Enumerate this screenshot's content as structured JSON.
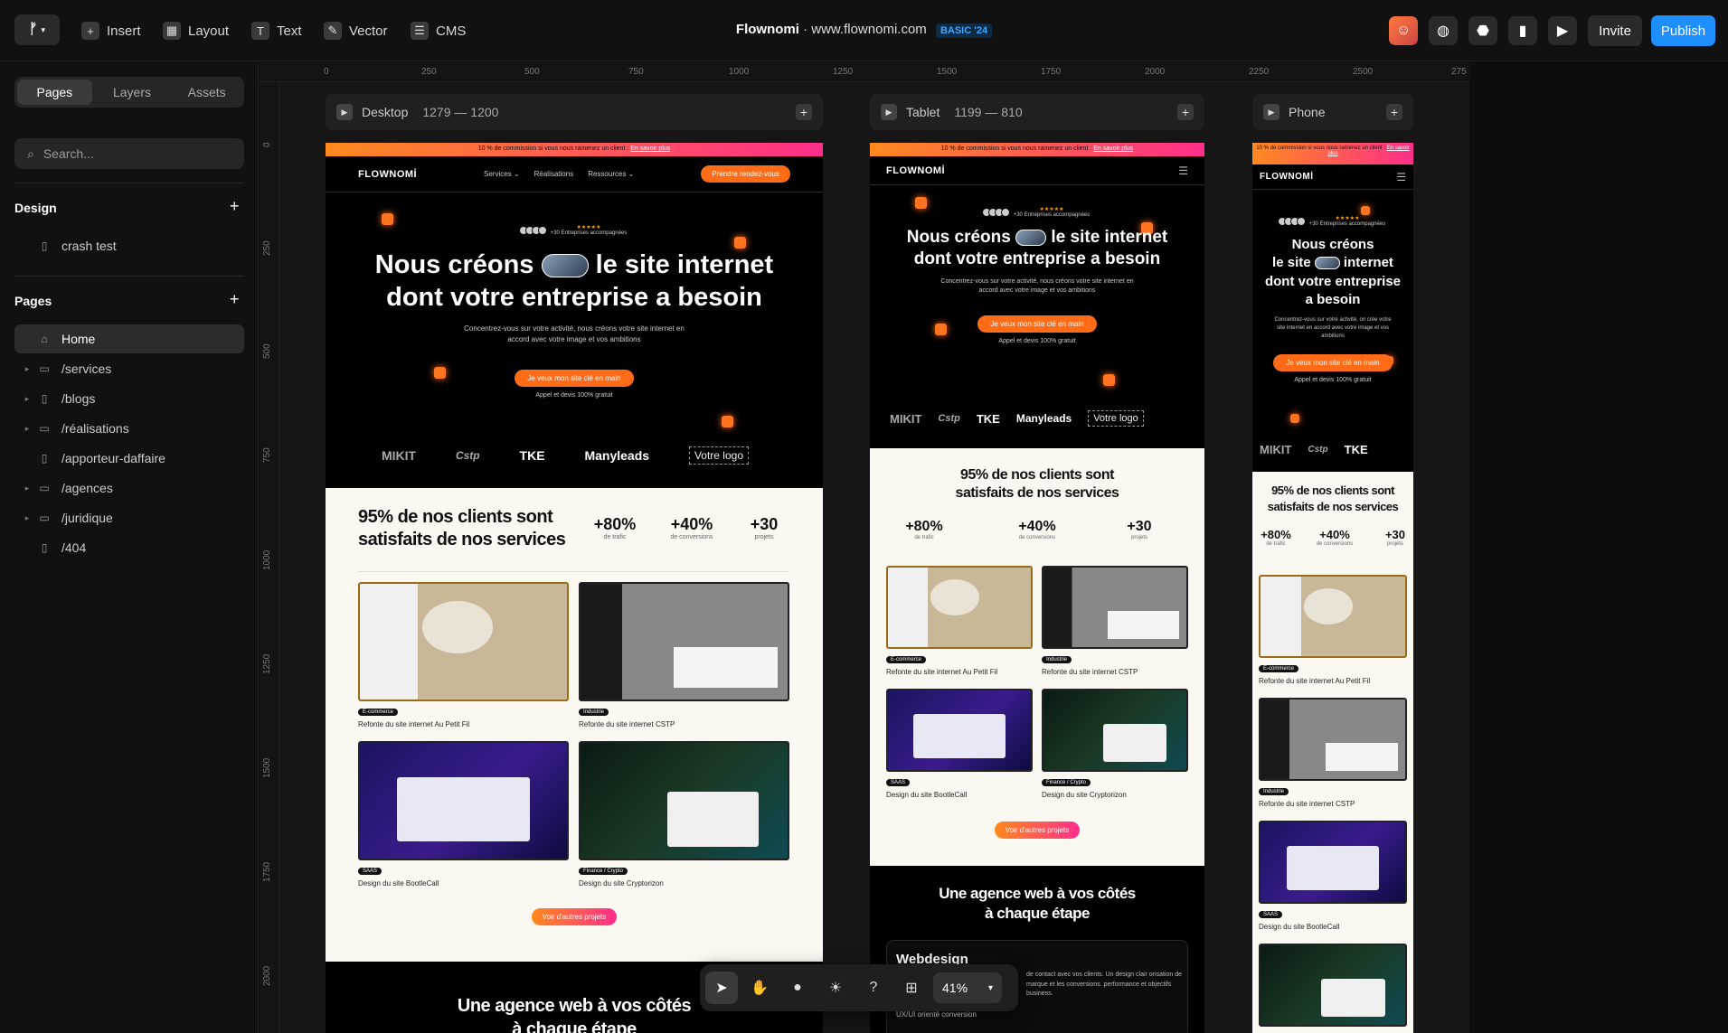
{
  "topbar": {
    "insert": "Insert",
    "layout": "Layout",
    "text": "Text",
    "vector": "Vector",
    "cms": "CMS",
    "project_name": "Flownomi",
    "separator": "·",
    "domain": "www.flownomi.com",
    "plan_badge": "BASIC '24",
    "invite": "Invite",
    "publish": "Publish"
  },
  "sidebar": {
    "tabs": [
      "Pages",
      "Layers",
      "Assets"
    ],
    "search_placeholder": "Search...",
    "design_title": "Design",
    "design_items": [
      "crash test"
    ],
    "pages_title": "Pages",
    "pages": [
      {
        "label": "Home",
        "icon": "home-icon",
        "active": true
      },
      {
        "label": "/services",
        "icon": "folder-icon"
      },
      {
        "label": "/blogs",
        "icon": "page-icon"
      },
      {
        "label": "/réalisations",
        "icon": "folder-icon"
      },
      {
        "label": "/apporteur-daffaire",
        "icon": "page-icon"
      },
      {
        "label": "/agences",
        "icon": "folder-icon"
      },
      {
        "label": "/juridique",
        "icon": "folder-icon"
      },
      {
        "label": "/404",
        "icon": "page-icon"
      }
    ]
  },
  "rulers": {
    "h": [
      "0",
      "250",
      "500",
      "750",
      "1000",
      "1250",
      "1500",
      "1750",
      "2000",
      "2250",
      "2500",
      "275"
    ],
    "v": [
      "0",
      "250",
      "500",
      "750",
      "1000",
      "1250",
      "1500",
      "1750",
      "2000"
    ]
  },
  "breakpoints": {
    "desktop": {
      "name": "Desktop",
      "size": "1279 — 1200"
    },
    "tablet": {
      "name": "Tablet",
      "size": "1199 — 810"
    },
    "phone": {
      "name": "Phone",
      "size": ""
    }
  },
  "site": {
    "promo": "10 % de commission si vous nous ramenez un client :",
    "promo_link": "En savoir plus",
    "brand": "FLOWNOMİ",
    "nav": [
      "Services ⌄",
      "Réalisations",
      "Ressources ⌄"
    ],
    "nav_cta": "Prendre rendez-vous",
    "reviews_stars": "★★★★★",
    "reviews_text": "+30 Entreprises accompagnées",
    "hero_part1": "Nous créons",
    "hero_part2": "le site internet",
    "hero_part3": "dont votre entreprise a besoin",
    "phone_hero_part1": "Nous créons",
    "phone_hero_part2": "le site",
    "phone_hero_part3": "internet",
    "phone_hero_part4": "dont votre entreprise",
    "phone_hero_part5": "a besoin",
    "hero_sub": "Concentrez-vous sur votre activité, nous créons votre site internet en accord avec votre image et vos ambitions",
    "phone_hero_sub": "Concentrez-vous sur votre activité, on crée votre site internet en accord avec votre image et vos ambitions",
    "hero_cta": "Je veux mon site clé en main",
    "hero_note": "Appel et devis 100% gratuit",
    "logos": [
      "MIKIT",
      "Cstp",
      "TKE",
      "Manyleads",
      "Votre logo"
    ],
    "stats_title": "95% de nos clients sont satisfaits de nos services",
    "stats": [
      {
        "value": "+80%",
        "label": "de trafic"
      },
      {
        "value": "+40%",
        "label": "de conversions"
      },
      {
        "value": "+30",
        "label": "projets"
      }
    ],
    "projects": [
      {
        "tag": "E-commerce",
        "title": "Refonte du site internet Au Petit Fil"
      },
      {
        "tag": "Industrie",
        "title": "Refonte du site internet CSTP"
      },
      {
        "tag": "SAAS",
        "title": "Design du site BootleCall"
      },
      {
        "tag": "Finance / Crypto",
        "title": "Design du site Cryptorizon"
      }
    ],
    "more_projects": "Voir d'autres projets",
    "agency_title": "Une agence web à vos côtés à chaque étape",
    "webdesign": "Webdesign",
    "webdesign_text": "de contact avec vos clients. Un design clair orisation de marque et les conversions. performance et objectifs business.",
    "uxui": "UX/UI orienté conversion"
  },
  "toolbar": {
    "zoom": "41%"
  },
  "colors": {
    "accent": "#1e8fff",
    "orange": "#ff6b17",
    "pink": "#ff2e8a"
  }
}
